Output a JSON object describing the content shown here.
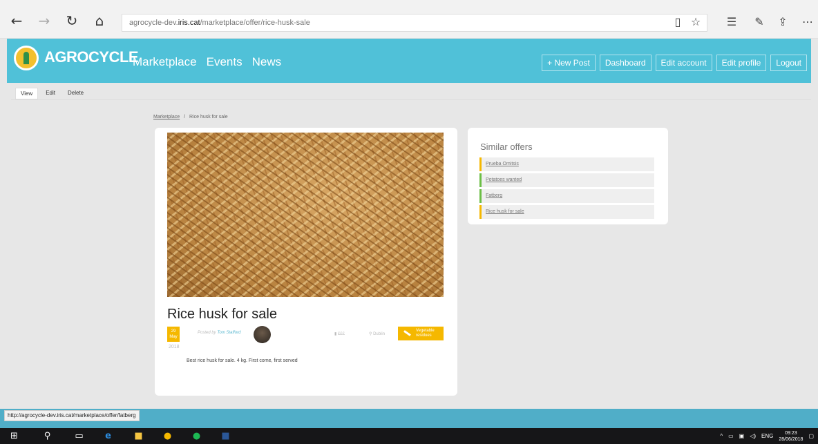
{
  "browser": {
    "url_prefix": "agrocycle-dev.",
    "url_domain": "iris.cat",
    "url_path": "/marketplace/offer/rice-husk-sale"
  },
  "header": {
    "logo": "AGROCYCLE",
    "nav": [
      "Marketplace",
      "Events",
      "News"
    ],
    "user_nav": [
      "+ New Post",
      "Dashboard",
      "Edit account",
      "Edit profile",
      "Logout"
    ]
  },
  "tabs": [
    "View",
    "Edit",
    "Delete"
  ],
  "breadcrumb": {
    "home": "Marketplace",
    "sep": "/",
    "current": "Rice husk for sale"
  },
  "offer": {
    "title": "Rice husk for sale",
    "date_day": "29",
    "date_month": "May",
    "date_year": "2018",
    "posted_by_label": "Posted by",
    "author": "Tom Stafford",
    "price": "£££",
    "location": "Dublin",
    "tag": "Vegetable residues",
    "description": "Best rice husk for sale. 4 kg. First come, first served"
  },
  "similar": {
    "title": "Similar offers",
    "items": [
      {
        "label": "Prueba Omitsis",
        "color": "#f5b800"
      },
      {
        "label": "Potatoes wanted",
        "color": "#6cbe45"
      },
      {
        "label": "Fatberg",
        "color": "#6cbe45"
      },
      {
        "label": "Rice husk for sale",
        "color": "#f5b800"
      }
    ]
  },
  "status_bar": {
    "url": "http://agrocycle-dev.iris.cat/marketplace/offer/fatberg"
  },
  "taskbar": {
    "lang": "ENG",
    "time": "09:23",
    "date": "28/06/2018"
  },
  "colors": {
    "header": "#50c1d8",
    "accent": "#f5b800",
    "band": "#50aec8"
  }
}
